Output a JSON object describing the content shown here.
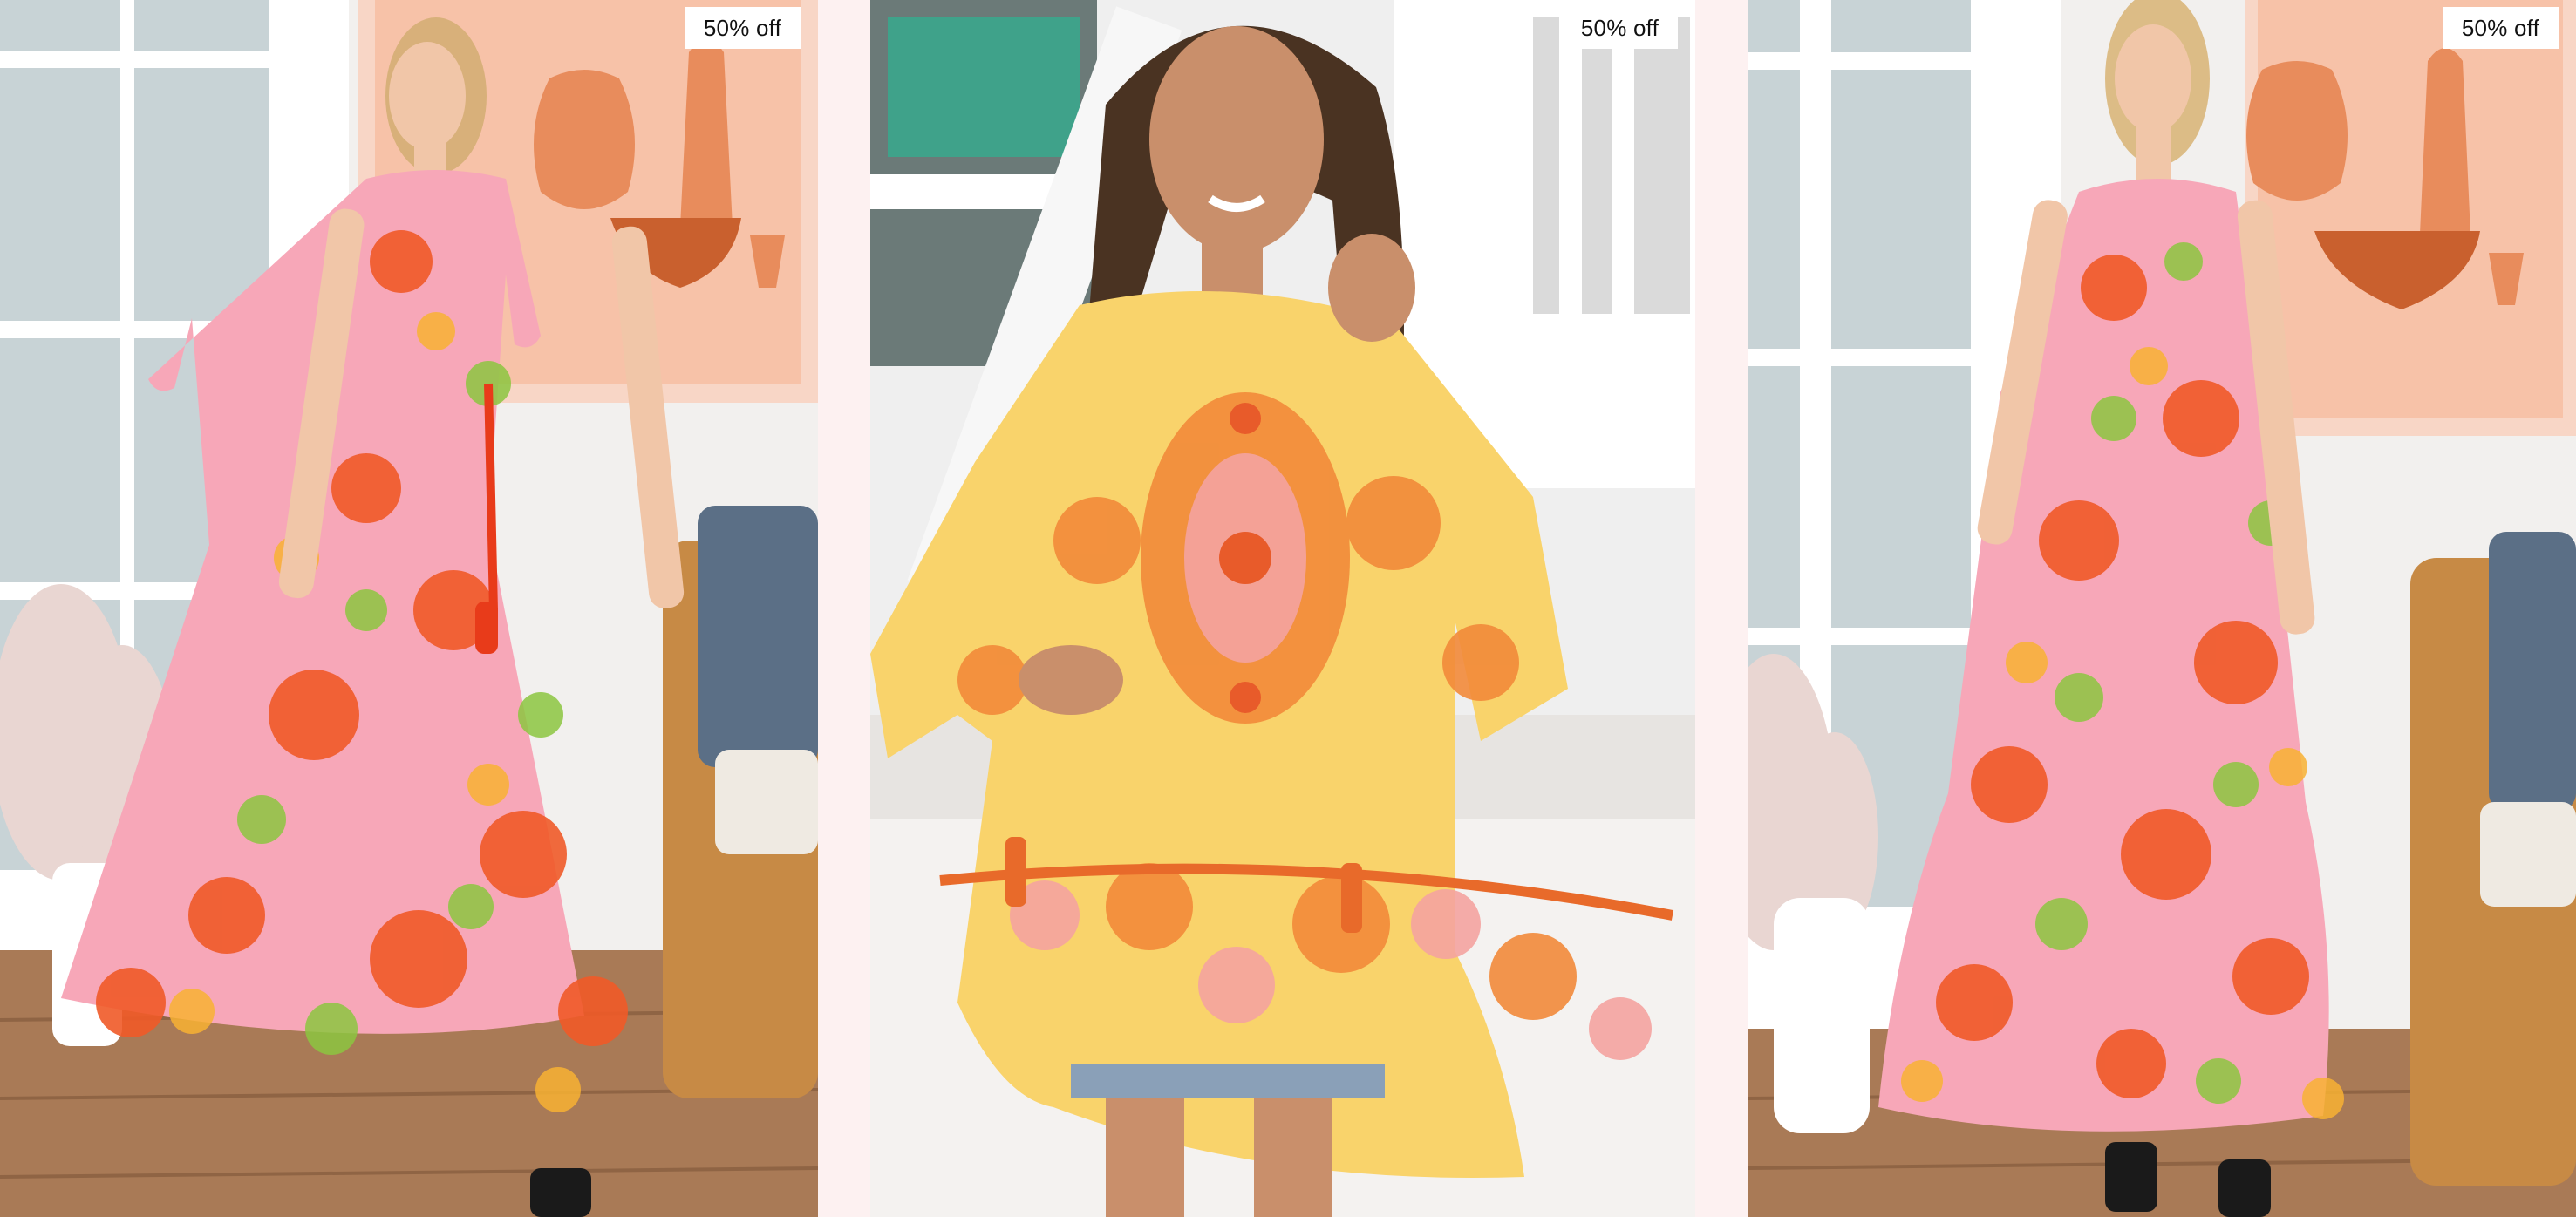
{
  "products": [
    {
      "badge": "50% off",
      "image_alt": "Woman in a pink and orange floral print short-sleeve maxi dress with tie waist",
      "colors": {
        "print_primary": "#f05a28",
        "print_secondary": "#f7a7b8",
        "print_accent": "#8cc63f"
      }
    },
    {
      "badge": "50% off",
      "image_alt": "Smiling woman in an orange and yellow paisley print bell-sleeve tunic dress",
      "colors": {
        "print_primary": "#f28a3a",
        "print_secondary": "#f9d36b",
        "print_accent": "#f4a3a0"
      }
    },
    {
      "badge": "50% off",
      "image_alt": "Woman in a pink, green and orange floral print strappy tiered maxi dress",
      "colors": {
        "print_primary": "#f05a28",
        "print_secondary": "#f7a7b8",
        "print_accent": "#8cc63f"
      }
    }
  ],
  "colors": {
    "page_background": "#fdf1f1",
    "badge_background": "#ffffff",
    "badge_text": "#111111"
  }
}
